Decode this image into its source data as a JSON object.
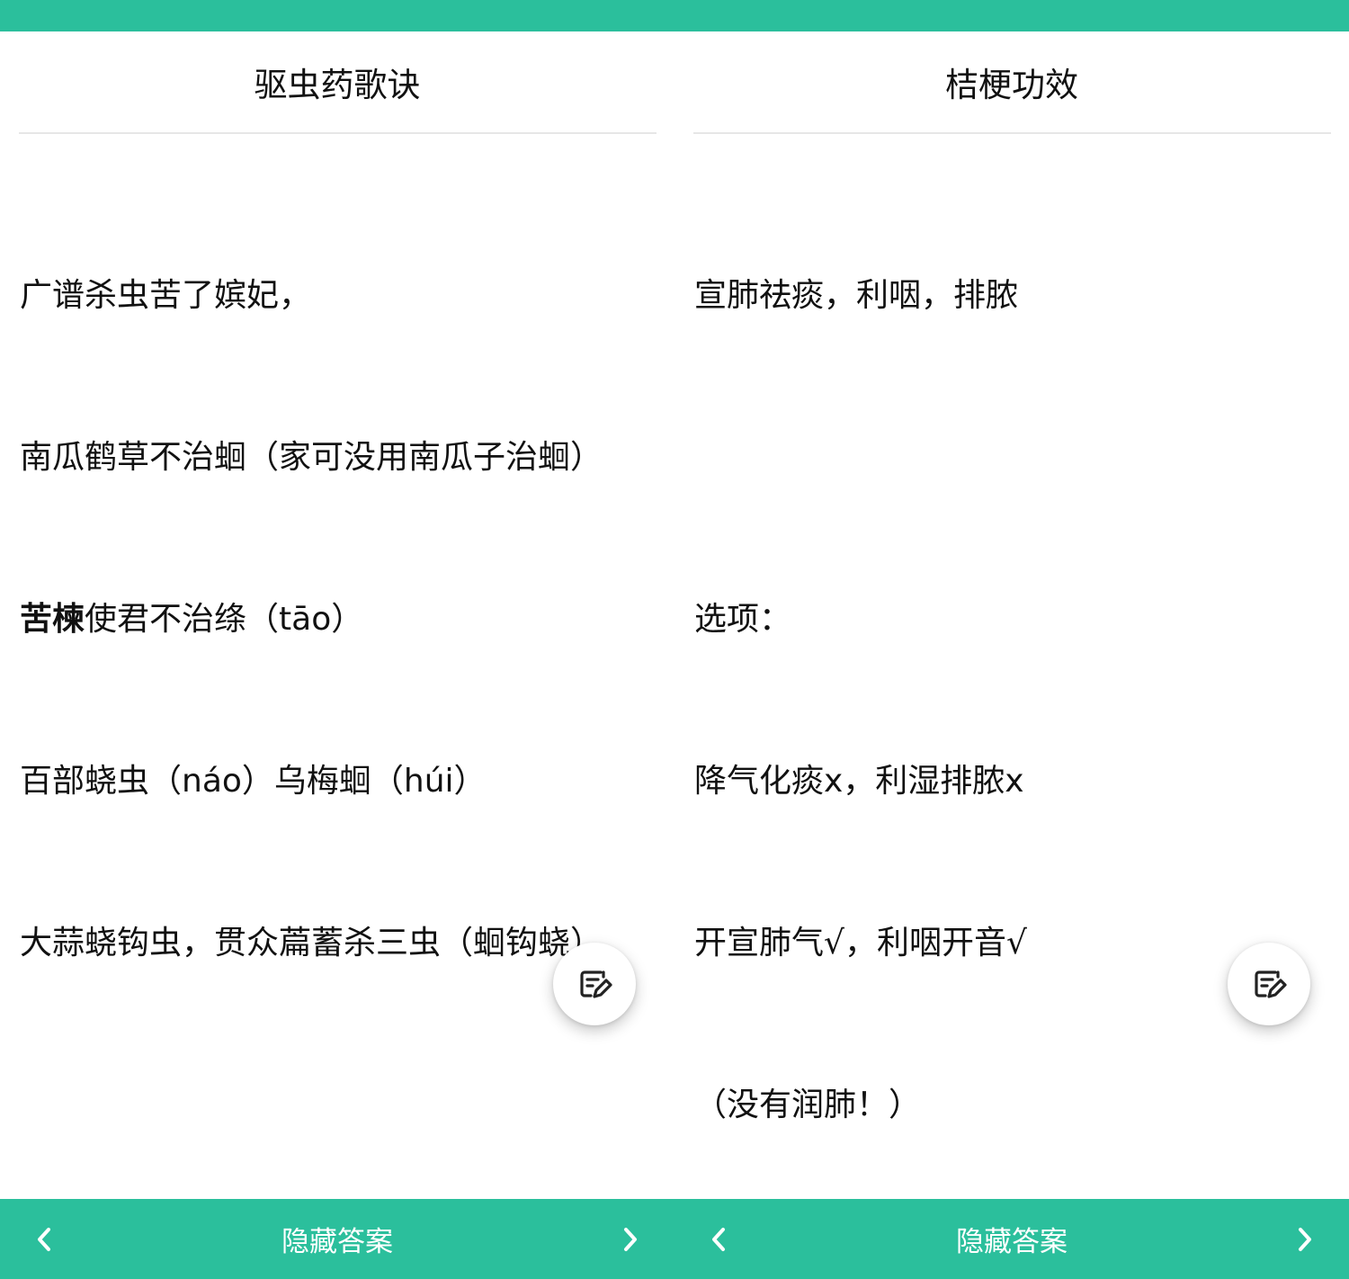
{
  "left_card": {
    "title": "驱虫药歌诀",
    "lines": [
      {
        "bold": "",
        "text": "广谱杀虫苦了嫔妃，"
      },
      {
        "bold": "",
        "text": "南瓜鹤草不治蛔（家可没用南瓜子治蛔）"
      },
      {
        "bold": "苦楝",
        "text": "使君不治绦（tāo）"
      },
      {
        "bold": "",
        "text": "百部蛲虫（náo）乌梅蛔（húi）"
      },
      {
        "bold": "",
        "text": "大蒜蛲钩虫，贯众萹蓄杀三虫（蛔钩蛲）"
      }
    ],
    "fab_icon": "edit-note-icon",
    "bottom": {
      "prev_icon": "chevron-left-icon",
      "label": "隐藏答案",
      "next_icon": "chevron-right-icon"
    }
  },
  "right_card": {
    "title": "桔梗功效",
    "lines": [
      {
        "text": "宣肺祛痰，利咽，排脓"
      },
      {
        "text": ""
      },
      {
        "text": "选项："
      },
      {
        "text": "降气化痰x，利湿排脓x"
      },
      {
        "text": "开宣肺气√，利咽开音√"
      },
      {
        "text": "（没有润肺！）"
      }
    ],
    "fab_icon": "edit-note-icon",
    "bottom": {
      "prev_icon": "chevron-left-icon",
      "label": "隐藏答案",
      "next_icon": "chevron-right-icon"
    }
  },
  "colors": {
    "accent": "#2bbf9c",
    "text": "#111111",
    "divider": "#e6e6e6"
  }
}
